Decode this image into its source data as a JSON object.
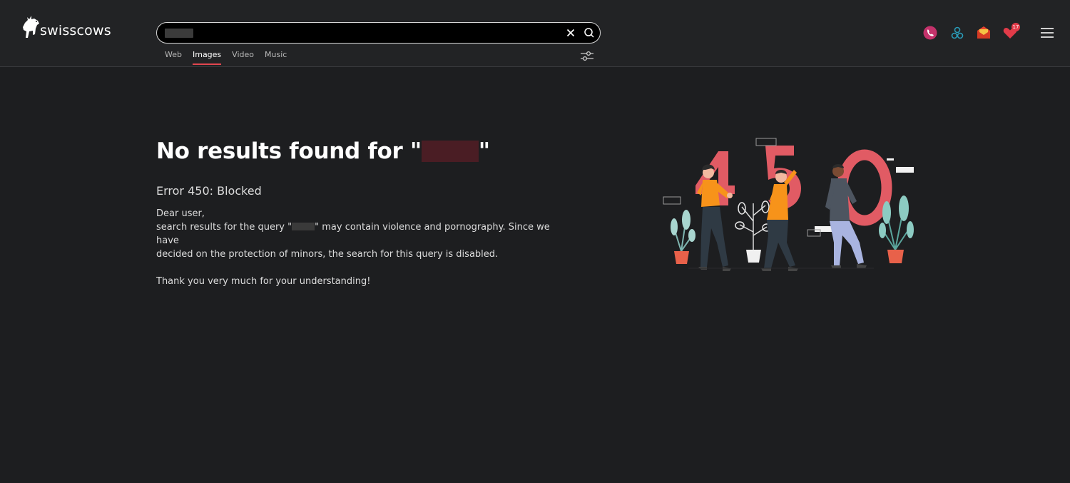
{
  "brand": {
    "name": "swisscows"
  },
  "search": {
    "value": "",
    "placeholder": ""
  },
  "tabs": [
    {
      "label": "Web",
      "active": false
    },
    {
      "label": "Images",
      "active": true
    },
    {
      "label": "Video",
      "active": false
    },
    {
      "label": "Music",
      "active": false
    }
  ],
  "header_icons": [
    "teleguard-icon",
    "vpn-icon",
    "mail-icon",
    "heart-icon",
    "menu-icon"
  ],
  "badge": {
    "count": "17"
  },
  "content": {
    "title_prefix": "No results found for \"",
    "title_suffix": "\"",
    "error": "Error 450: Blocked",
    "greeting": "Dear user,",
    "msg_part1": "search results for the query \"",
    "msg_part2": "\" may contain violence and pornography. Since we have",
    "msg_line2": "decided on the protection of minors, the search for this query is disabled.",
    "thanks": "Thank you very much for your understanding!"
  },
  "colors": {
    "accent": "#e2464f",
    "background": "#1d1e20",
    "header": "#222325",
    "illustration_red": "#e15b64",
    "orange": "#f7931a"
  }
}
